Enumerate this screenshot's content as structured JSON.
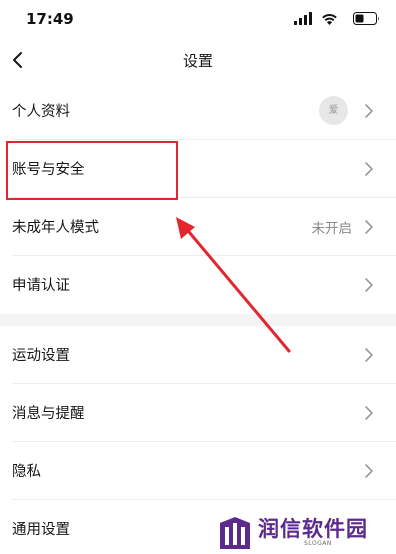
{
  "status_bar": {
    "time": "17:49"
  },
  "header": {
    "title": "设置"
  },
  "settings_group_1": [
    {
      "label": "个人资料",
      "avatar_text": "爱"
    },
    {
      "label": "账号与安全"
    },
    {
      "label": "未成年人模式",
      "value": "未开启"
    },
    {
      "label": "申请认证"
    }
  ],
  "settings_group_2": [
    {
      "label": "运动设置"
    },
    {
      "label": "消息与提醒"
    },
    {
      "label": "隐私"
    },
    {
      "label": "通用设置"
    }
  ],
  "annotation": {
    "color": "#e3262e",
    "highlighted_item": "账号与安全"
  },
  "watermark": {
    "text": "润信软件园",
    "slogan": "SLOGAN",
    "color": "#5b2a8c"
  }
}
